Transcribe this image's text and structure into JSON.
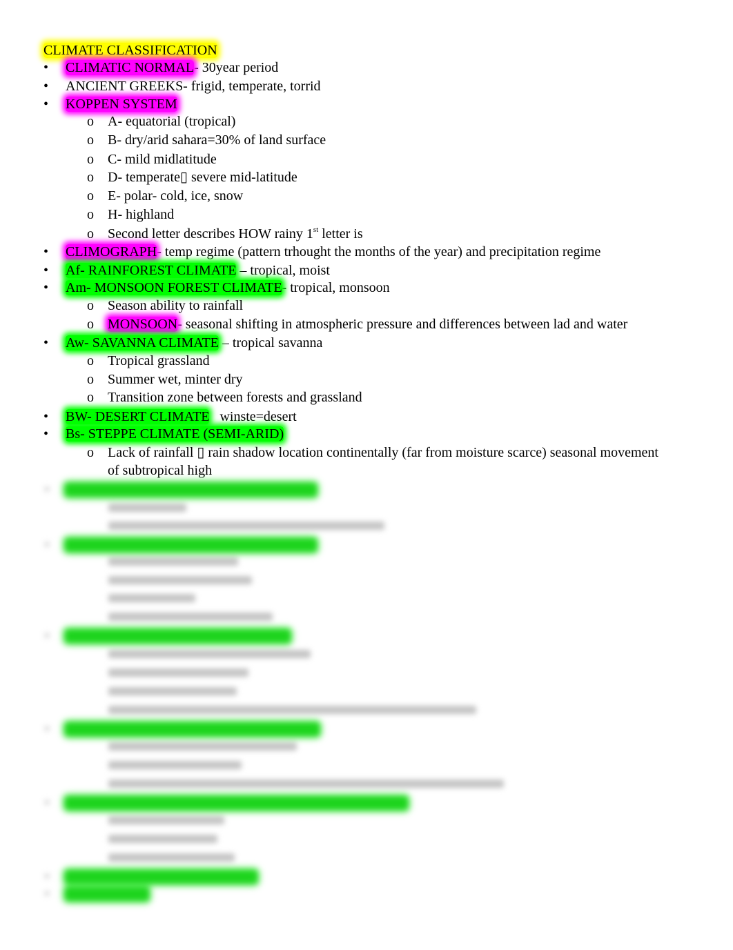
{
  "document": {
    "title": "CLIMATE CLASSIFICATION",
    "bullet_glyph": "•",
    "sub_bullet_glyph": "o",
    "items": [
      {
        "highlight": "CLIMATIC NORMAL",
        "highlight_color": "#ff00ff",
        "text": "- 30year period"
      },
      {
        "highlight": "",
        "text": "ANCIENT GREEKS- frigid, temperate, torrid"
      },
      {
        "highlight": "KOPPEN SYSTEM",
        "highlight_color": "#ff00ff",
        "text": "",
        "children": [
          {
            "text": "A- equatorial (tropical)"
          },
          {
            "text": "B- dry/arid sahara=30% of land surface"
          },
          {
            "text": "C- mild midlatitude"
          },
          {
            "text": "D- temperate▯ severe mid-latitude"
          },
          {
            "text": "E- polar- cold, ice, snow"
          },
          {
            "text": "H- highland"
          },
          {
            "text": "Second letter describes HOW rainy 1",
            "sup": "st",
            "text_after": " letter is"
          }
        ]
      },
      {
        "highlight": "CLIMOGRAPH",
        "highlight_color": "#ff00ff",
        "text": "- temp regime (pattern trhought the months of the year) and precipitation regime"
      },
      {
        "highlight": "Af- RAINFOREST CLIMATE",
        "highlight_color": "#00ff00",
        "text": " – tropical, moist"
      },
      {
        "highlight": "Am- MONSOON FOREST CLIMATE",
        "highlight_color": "#00ff00",
        "text": "- tropical, monsoon",
        "children": [
          {
            "text": "Season ability to rainfall"
          },
          {
            "highlight": "MONSOON",
            "highlight_color": "#ff00ff",
            "text": "- seasonal shifting in atmospheric pressure and differences between lad and water"
          }
        ]
      },
      {
        "highlight": "Aw- SAVANNA CLIMATE",
        "highlight_color": "#00ff00",
        "text": " – tropical savanna",
        "children": [
          {
            "text": "Tropical grassland"
          },
          {
            "text": "Summer wet, minter dry"
          },
          {
            "text": "Transition zone between forests and grassland"
          }
        ]
      },
      {
        "highlight": "BW- DESERT CLIMATE",
        "highlight_color": "#00ff00",
        "text": "   winste=desert"
      },
      {
        "highlight": "Bs- STEPPE CLIMATE (SEMI-ARID)",
        "highlight_color": "#00ff00",
        "text": "",
        "children": [
          {
            "text": "Lack of rainfall ▯ rain shadow location continentally (far from moisture scarce) seasonal movement",
            "text_line2": "of subtropical high"
          }
        ]
      }
    ],
    "blurred_preview": "remaining content obscured"
  }
}
